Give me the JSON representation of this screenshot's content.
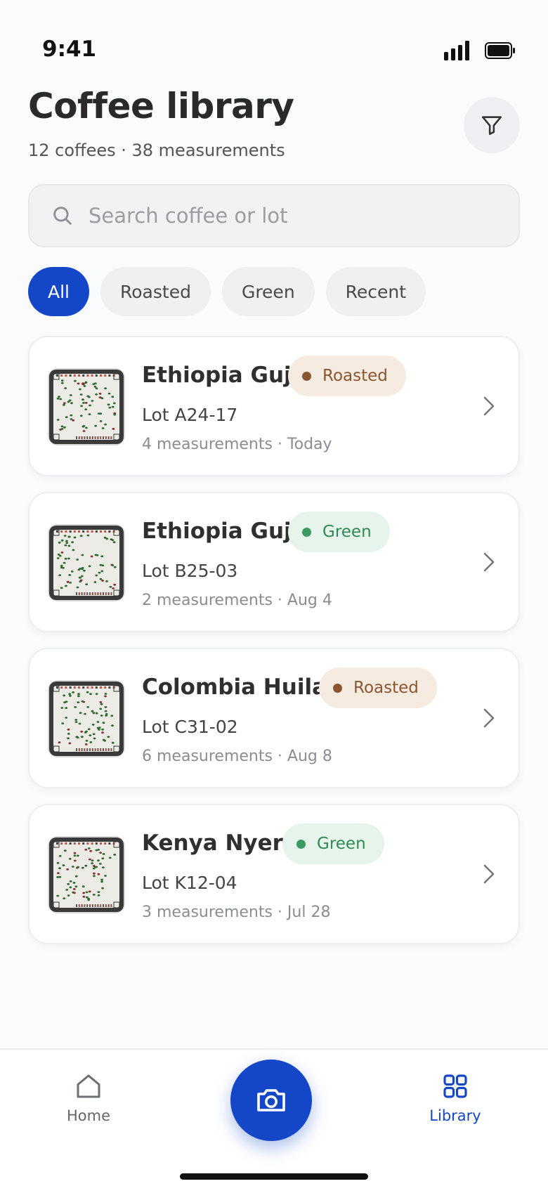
{
  "status_bar": {
    "time": "9:41"
  },
  "header": {
    "title": "Coffee library",
    "subtitle": "12 coffees · 38 measurements",
    "filter_icon": "filter-funnel-icon"
  },
  "search": {
    "placeholder": "Search coffee or lot",
    "value": ""
  },
  "filters": {
    "chips": [
      {
        "label": "All",
        "active": true
      },
      {
        "label": "Roasted",
        "active": false
      },
      {
        "label": "Green",
        "active": false
      },
      {
        "label": "Recent",
        "active": false
      }
    ]
  },
  "coffees": [
    {
      "name": "Ethiopia Guji",
      "status": "Roasted",
      "lot": "Lot A24-17",
      "meta": "4 measurements · Today"
    },
    {
      "name": "Ethiopia Guji",
      "status": "Green",
      "lot": "Lot B25-03",
      "meta": "2 measurements · Aug 4"
    },
    {
      "name": "Colombia Huila",
      "status": "Roasted",
      "lot": "Lot C31-02",
      "meta": "6 measurements · Aug 8"
    },
    {
      "name": "Kenya Nyeri",
      "status": "Green",
      "lot": "Lot K12-04",
      "meta": "3 measurements · Jul 28"
    }
  ],
  "tab_bar": {
    "home_label": "Home",
    "library_label": "Library",
    "active_tab": "Library",
    "camera_icon": "camera-icon"
  },
  "colors": {
    "accent": "#1447c8",
    "roasted_text": "#8a5630",
    "roasted_bg": "#f6ebe1",
    "green_text": "#2f8a55",
    "green_bg": "#e6f4ec"
  }
}
